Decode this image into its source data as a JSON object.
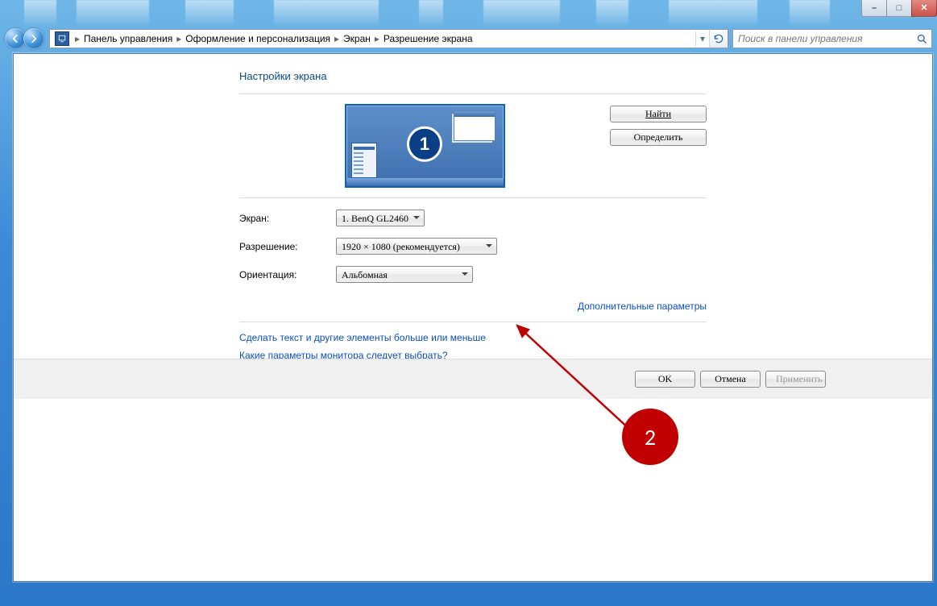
{
  "window_buttons": {
    "min": "–",
    "max": "□",
    "close": "✕"
  },
  "breadcrumb": {
    "crumb1": "Панель управления",
    "crumb2": "Оформление и персонализация",
    "crumb3": "Экран",
    "crumb4": "Разрешение экрана"
  },
  "search": {
    "placeholder": "Поиск в панели управления"
  },
  "page": {
    "title": "Настройки экрана",
    "monitor_number": "1",
    "find_btn": "Найти",
    "detect_btn": "Определить",
    "label_display": "Экран:",
    "label_resolution": "Разрешение:",
    "label_orientation": "Ориентация:",
    "display_value": "1. BenQ GL2460",
    "resolution_value": "1920 × 1080 (рекомендуется)",
    "orientation_value": "Альбомная",
    "advanced_link": "Дополнительные параметры",
    "textsize_link": "Сделать текст и другие элементы больше или меньше",
    "which_link": "Какие параметры монитора следует выбрать?",
    "ok": "OK",
    "cancel": "Отмена",
    "apply": "Применить"
  },
  "annotation": {
    "label": "2"
  }
}
